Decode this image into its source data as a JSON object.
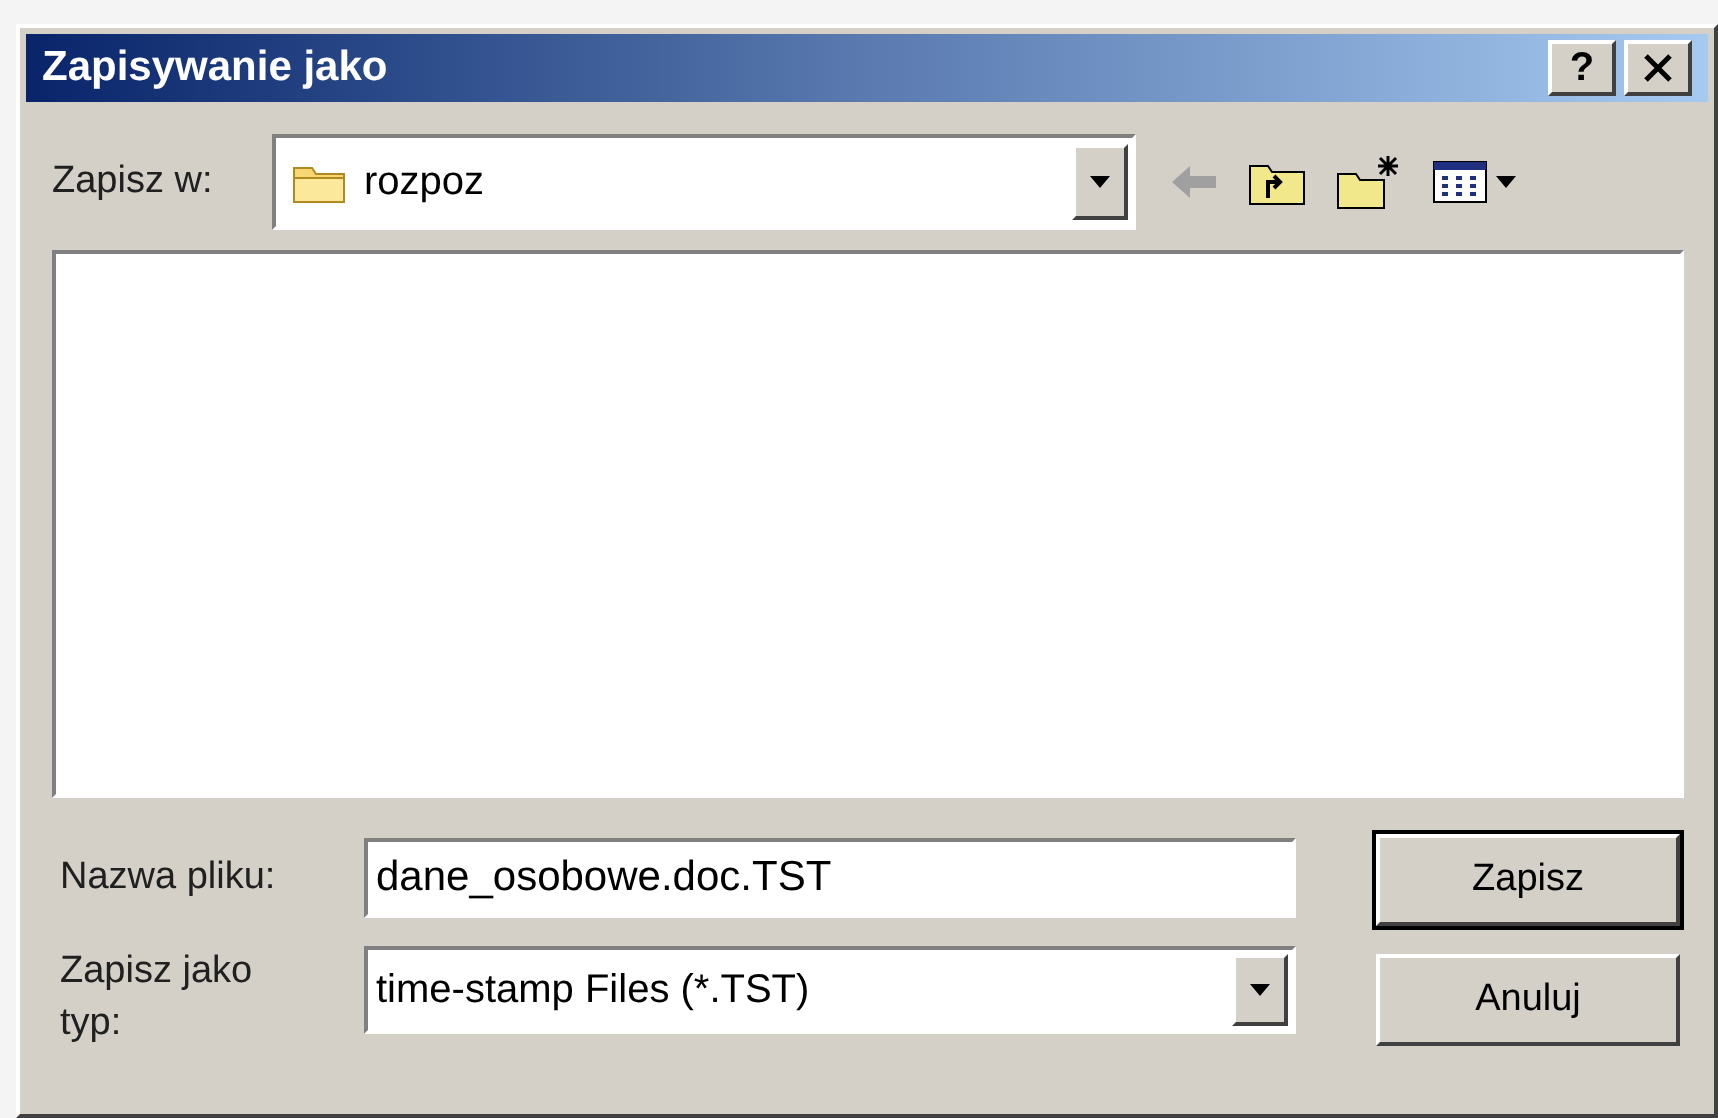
{
  "window": {
    "title": "Zapisywanie jako",
    "help": "?"
  },
  "location": {
    "label": "Zapisz w:",
    "value": "rozpoz"
  },
  "toolbar": [
    {
      "kind": "back",
      "disabled": true
    },
    {
      "kind": "up",
      "disabled": false
    },
    {
      "kind": "new_folder",
      "disabled": false
    },
    {
      "kind": "view",
      "disabled": false
    }
  ],
  "file_name": {
    "label": "Nazwa pliku:",
    "value": "dane_osobowe.doc.TST"
  },
  "file_type": {
    "label": "Zapisz jako typ:",
    "value": "time-stamp Files (*.TST)"
  },
  "buttons": [
    {
      "label": "Zapisz",
      "default": true
    },
    {
      "label": "Anuluj",
      "default": false
    }
  ]
}
